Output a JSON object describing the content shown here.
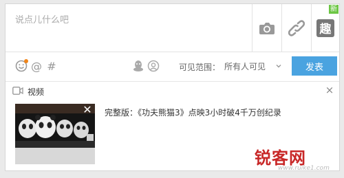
{
  "composer": {
    "placeholder": "说点儿什么吧",
    "side_buttons": [
      {
        "name": "camera-icon"
      },
      {
        "name": "link-icon"
      },
      {
        "name": "fun-icon",
        "label": "趣",
        "badge": "新"
      }
    ]
  },
  "toolbar": {
    "icons": [
      "emoji-icon",
      "at-icon",
      "hash-icon",
      "qq-icon",
      "face-icon"
    ],
    "at_symbol": "@",
    "hash_symbol": "#",
    "visibility_label": "可见范围：",
    "visibility_value": "所有人可见",
    "post_label": "发表"
  },
  "attachment": {
    "section_label": "视频",
    "close_symbol": "×",
    "thumb_close": "✕",
    "video_title": "完整版：《功夫熊猫3》点映3小时破4千万创纪录"
  },
  "watermark": {
    "text": "锐客网",
    "url": "www.ruike1.com"
  },
  "colors": {
    "accent": "#4aa3e0",
    "badge_green": "#6cc644",
    "notify_orange": "#f08519",
    "watermark_red": "#c82727"
  }
}
